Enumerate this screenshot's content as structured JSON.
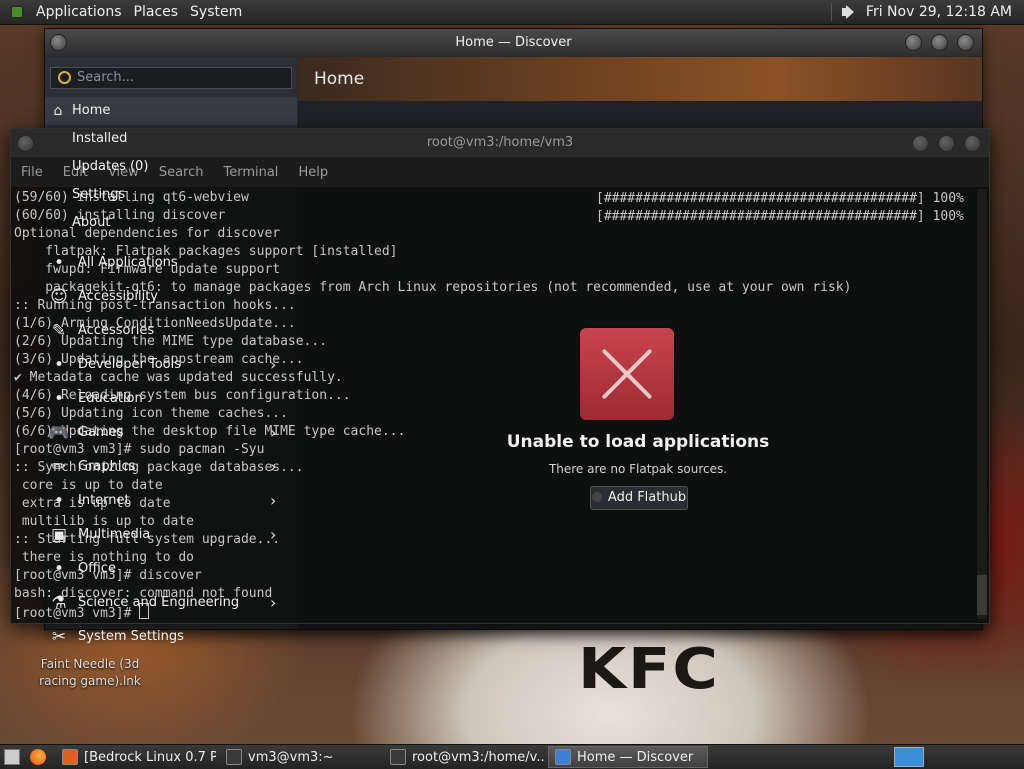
{
  "top_panel": {
    "menus": [
      "Applications",
      "Places",
      "System"
    ],
    "clock": "Fri Nov 29, 12:18 AM"
  },
  "desktop": {
    "icon_label": "Faint Needle (3d racing game).lnk",
    "wallpaper_text": "KFC"
  },
  "discover": {
    "title": "Home — Discover",
    "search_placeholder": "Search...",
    "header": "Home",
    "nav_top": [
      "Home",
      "Installed",
      "Updates (0)",
      "Settings",
      "About"
    ],
    "categories": [
      {
        "label": "All Applications",
        "icon": "grid-icon",
        "chevron": false
      },
      {
        "label": "Accessibility",
        "icon": "accessibility-icon",
        "chevron": false
      },
      {
        "label": "Accessories",
        "icon": "accessories-icon",
        "chevron": false
      },
      {
        "label": "Developer Tools",
        "icon": "developer-icon",
        "chevron": true
      },
      {
        "label": "Education",
        "icon": "education-icon",
        "chevron": false
      },
      {
        "label": "Games",
        "icon": "gamepad-icon",
        "chevron": true
      },
      {
        "label": "Graphics",
        "icon": "graphics-icon",
        "chevron": true
      },
      {
        "label": "Internet",
        "icon": "internet-icon",
        "chevron": true
      },
      {
        "label": "Multimedia",
        "icon": "multimedia-icon",
        "chevron": true
      },
      {
        "label": "Office",
        "icon": "office-icon",
        "chevron": false
      },
      {
        "label": "Science and Engineering",
        "icon": "science-icon",
        "chevron": true
      },
      {
        "label": "System Settings",
        "icon": "tools-icon",
        "chevron": false
      }
    ],
    "empty_title": "Unable to load applications",
    "empty_subtitle": "There are no Flatpak sources.",
    "add_button": "Add Flathub"
  },
  "terminal": {
    "title": "root@vm3:/home/vm3",
    "menus": [
      "File",
      "Edit",
      "View",
      "Search",
      "Terminal",
      "Help"
    ],
    "progress_bars": [
      "[########################################] 100%",
      "[########################################] 100%"
    ],
    "lines": [
      "(59/60) installing qt6-webview",
      "(60/60) installing discover",
      "Optional dependencies for discover",
      "    flatpak: Flatpak packages support [installed]",
      "    fwupd: Firmware update support",
      "    packagekit-qt6: to manage packages from Arch Linux repositories (not recommended, use at your own risk)",
      ":: Running post-transaction hooks...",
      "(1/6) Arming ConditionNeedsUpdate...",
      "(2/6) Updating the MIME type database...",
      "(3/6) Updating the appstream cache...",
      "✔ Metadata cache was updated successfully.",
      "(4/6) Reloading system bus configuration...",
      "(5/6) Updating icon theme caches...",
      "(6/6) Updating the desktop file MIME type cache...",
      "[root@vm3 vm3]# sudo pacman -Syu",
      ":: Synchronizing package databases...",
      " core is up to date",
      " extra is up to date",
      " multilib is up to date",
      ":: Starting full system upgrade...",
      " there is nothing to do",
      "[root@vm3 vm3]# discover",
      "bash: discover: command not found",
      "[root@vm3 vm3]# "
    ]
  },
  "taskbar": {
    "tasks": [
      "[Bedrock Linux 0.7 P...",
      "vm3@vm3:~",
      "root@vm3:/home/v...",
      "Home — Discover"
    ],
    "active_index": 3
  }
}
